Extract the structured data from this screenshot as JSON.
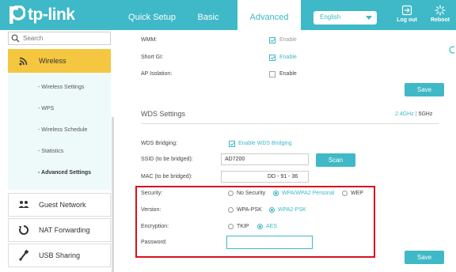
{
  "header": {
    "brand": "tp-link",
    "tabs": [
      "Quick Setup",
      "Basic",
      "Advanced"
    ],
    "language": "English",
    "logout_label": "Log out",
    "reboot_label": "Reboot"
  },
  "sidebar": {
    "search_placeholder": "Search",
    "wireless_label": "Wireless",
    "sub_items": [
      "- Wireless Settings",
      "- WPS",
      "- Wireless Schedule",
      "- Statistics",
      "- Advanced Settings"
    ],
    "guest_label": "Guest Network",
    "nat_label": "NAT Forwarding",
    "usb_label": "USB Sharing"
  },
  "main": {
    "wmm_label": "WMM:",
    "wmm_option": "Enable",
    "shortgi_label": "Short GI:",
    "shortgi_option": "Enable",
    "ap_label": "AP Isolation:",
    "ap_option": "Enable",
    "save_label": "Save",
    "wds_title": "WDS Settings",
    "band_24": "2.4GHz",
    "band_sep": "|",
    "band_5": "5GHz",
    "wds_bridging_label": "WDS Bridging:",
    "wds_bridging_option": "Enable WDS Bridging",
    "ssid_label": "SSID (to be bridged):",
    "ssid_value": "AD7200",
    "scan_label": "Scan",
    "mac_label": "MAC (to be bridged):",
    "mac_value": "DD - 91 - 36",
    "security_label": "Security:",
    "security_options": [
      "No Security",
      "WPA/WPA2 Personal",
      "WEP"
    ],
    "version_label": "Version:",
    "version_options": [
      "WPA-PSK",
      "WPA2-PSK"
    ],
    "encryption_label": "Encryption:",
    "encryption_options": [
      "TKIP",
      "AES"
    ],
    "password_label": "Password:",
    "password_value": "",
    "save2_label": "Save"
  },
  "colors": {
    "accent": "#3fb8c7",
    "highlight": "#f5c63f",
    "annotation": "#d9111c"
  }
}
